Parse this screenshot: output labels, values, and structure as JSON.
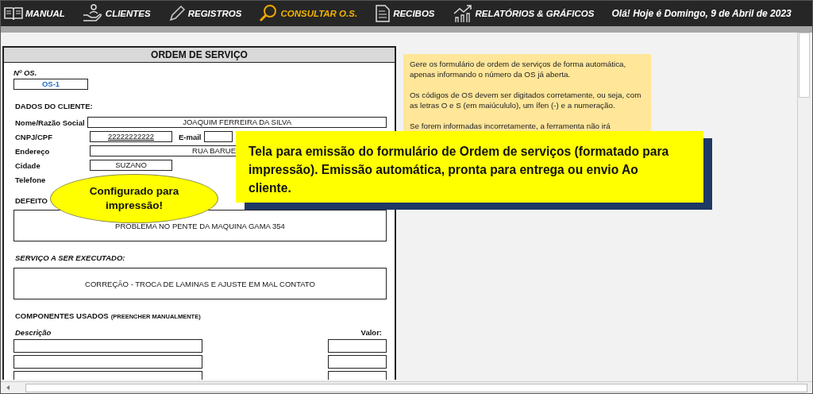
{
  "nav": {
    "items": [
      {
        "label": "MANUAL",
        "selected": false
      },
      {
        "label": "CLIENTES",
        "selected": false
      },
      {
        "label": "REGISTROS",
        "selected": false
      },
      {
        "label": "CONSULTAR O.S.",
        "selected": true
      },
      {
        "label": "RECIBOS",
        "selected": false
      },
      {
        "label": "RELATÓRIOS & GRÁFICOS",
        "selected": false
      }
    ],
    "greeting": "Olá! Hoje é Domingo, 9 de Abril de 2023"
  },
  "form": {
    "title": "ORDEM DE SERVIÇO",
    "os_label": "Nº OS.",
    "os_value": "OS-1",
    "client_heading": "DADOS DO CLIENTE:",
    "client_fields": [
      {
        "kind": "wide",
        "label": "Nome/Razão Social",
        "value": "JOAQUIM FERREIRA DA SILVA"
      },
      {
        "kind": "pair",
        "label": "CNPJ/CPF",
        "value": "22222222222",
        "label_2": "E-mail"
      },
      {
        "kind": "cut",
        "label": "Endereço",
        "value": "RUA BARUE"
      },
      {
        "kind": "short",
        "label": "Cidade",
        "value": "SUZANO"
      },
      {
        "kind": "bare",
        "label": "Telefone"
      }
    ],
    "defect_heading": "DEFEITO",
    "defect": "PROBLEMA NO PENTE DA MAQUINA GAMA 354",
    "service_heading": "SERVIÇO A SER EXECUTADO:",
    "service": "CORREÇÃO - TROCA DE LAMINAS E AJUSTE EM MAL CONTATO",
    "components_heading": "COMPONENTES USADOS",
    "components_note": "(PREENCHER MANUALMENTE)",
    "description_label": "Descrição",
    "value_label": "Valor:"
  },
  "note": {
    "paragraphs": [
      "Gere os formulário de  ordem de serviços de forma automática, apenas informando o número da OS já aberta.",
      "Os códigos de OS devem ser digitados corretamente, ou seja, com as letras O e S (em maiúcululo), um ífen (-) e a numeração.",
      "Se forem informadas incorretamente, a ferramenta não irá"
    ]
  },
  "banner": {
    "text": "Tela para emissão do formulário de Ordem de serviços (formatado para impressão). Emissão automática, pronta para entrega ou  envio Ao cliente."
  },
  "bubble": {
    "text": "Configurado para impressão!"
  }
}
